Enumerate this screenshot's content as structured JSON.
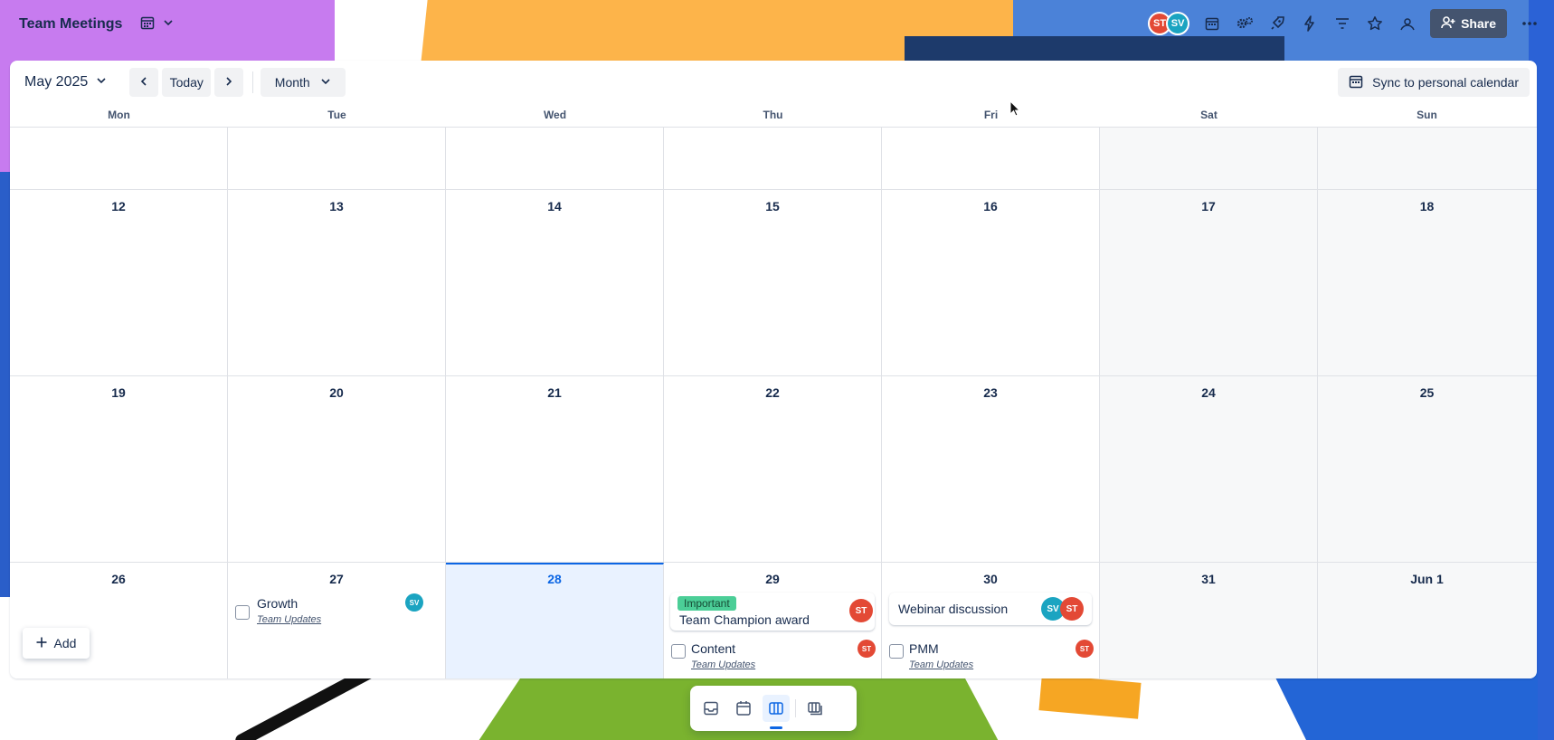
{
  "board": {
    "title": "Team Meetings"
  },
  "top_actions": {
    "share_label": "Share",
    "avatars": [
      "ST",
      "SV"
    ]
  },
  "toolbar": {
    "month_label": "May 2025",
    "today_label": "Today",
    "view_label": "Month",
    "sync_label": "Sync to personal calendar"
  },
  "weekdays": [
    "Mon",
    "Tue",
    "Wed",
    "Thu",
    "Fri",
    "Sat",
    "Sun"
  ],
  "weeks": [
    {
      "days": [
        "",
        "",
        "",
        "",
        "",
        "",
        ""
      ]
    },
    {
      "days": [
        "12",
        "13",
        "14",
        "15",
        "16",
        "17",
        "18"
      ]
    },
    {
      "days": [
        "19",
        "20",
        "21",
        "22",
        "23",
        "24",
        "25"
      ]
    },
    {
      "days": [
        "26",
        "27",
        "28",
        "29",
        "30",
        "31",
        "Jun 1"
      ]
    }
  ],
  "events": {
    "growth": {
      "title": "Growth",
      "list": "Team Updates",
      "member": "SV"
    },
    "team_champion": {
      "label": "Important",
      "title": "Team Champion award",
      "member": "ST"
    },
    "content": {
      "title": "Content",
      "list": "Team Updates",
      "member": "ST"
    },
    "webinar": {
      "title": "Webinar discussion",
      "members": [
        "SV",
        "ST"
      ]
    },
    "pmm": {
      "title": "PMM",
      "list": "Team Updates",
      "member": "ST"
    }
  },
  "add_button": {
    "label": "Add"
  },
  "colors": {
    "accent": "#0c66e4",
    "avatar_st": "#e34935",
    "avatar_sv": "#1ba4c1",
    "label_green": "#4bce97"
  }
}
